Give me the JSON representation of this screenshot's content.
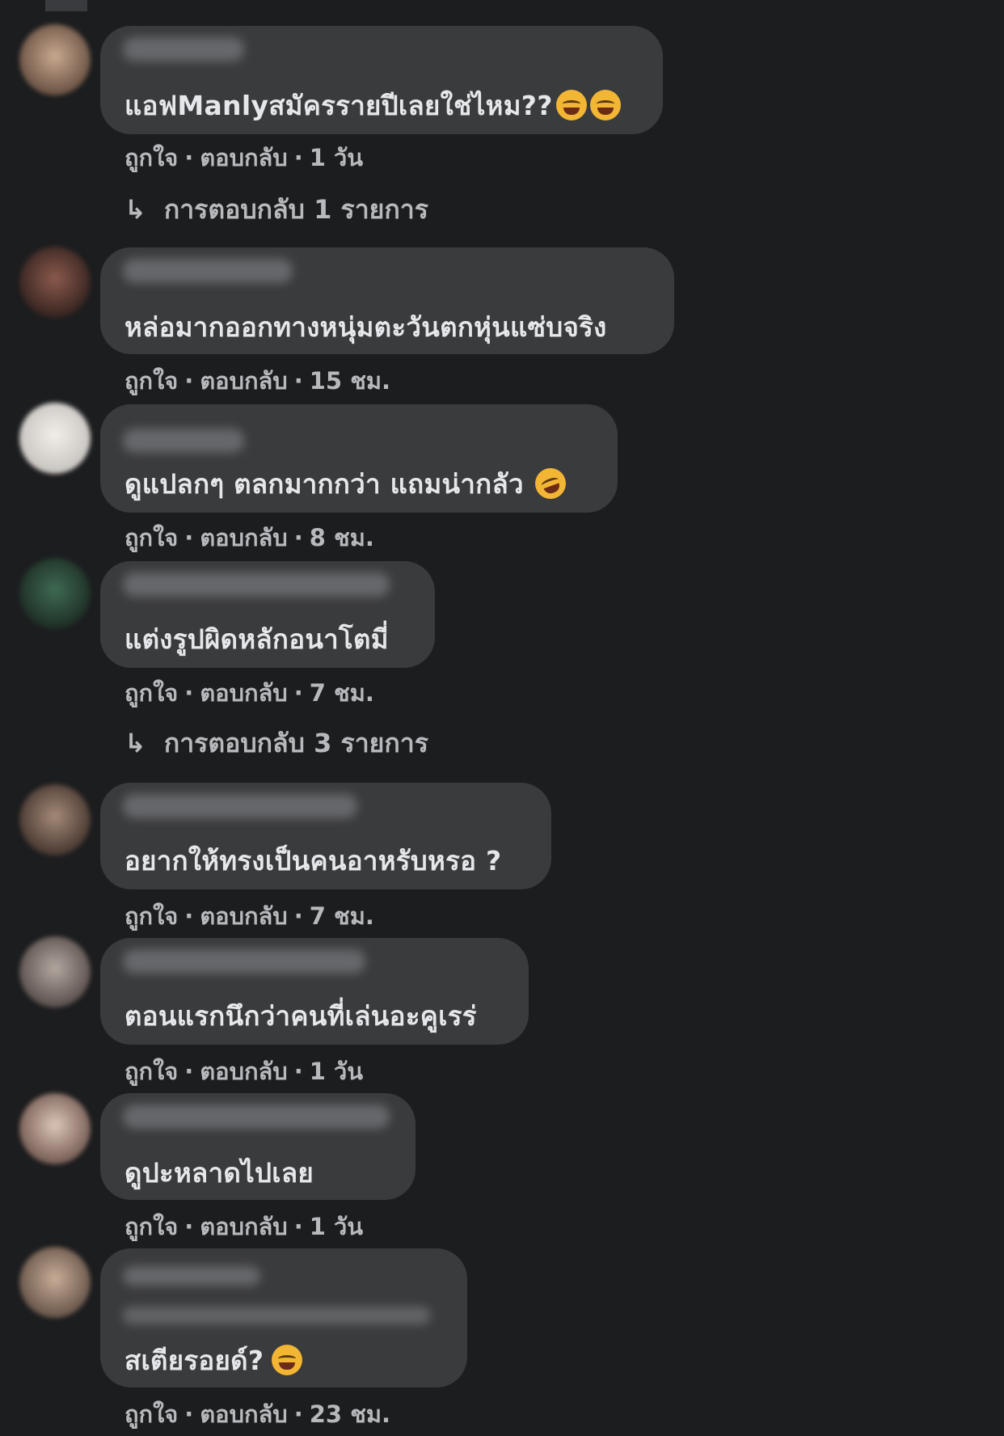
{
  "comments": [
    {
      "text": "แอฟManlyสมัครรายปีเลยใช่ไหม??",
      "emoji_icon": [
        "tears-of-joy-icon",
        "tears-of-joy-icon"
      ],
      "like": "ถูกใจ",
      "reply": "ตอบกลับ",
      "time": "1 วัน",
      "replies_label": "การตอบกลับ 1 รายการ"
    },
    {
      "text": "หล่อมากออกทางหนุ่มตะวันตกหุ่นแซ่บจริง",
      "like": "ถูกใจ",
      "reply": "ตอบกลับ",
      "time": "15 ชม."
    },
    {
      "text": "ดูแปลกๆ ตลกมากกว่า แถมน่ากลัว",
      "emoji_icon": [
        "rolling-laughing-icon"
      ],
      "like": "ถูกใจ",
      "reply": "ตอบกลับ",
      "time": "8 ชม."
    },
    {
      "text": "แต่งรูปผิดหลักอนาโตมี่",
      "like": "ถูกใจ",
      "reply": "ตอบกลับ",
      "time": "7 ชม.",
      "replies_label": "การตอบกลับ 3 รายการ"
    },
    {
      "text": "อยากให้ทรงเป็นคนอาหรับหรอ ?",
      "like": "ถูกใจ",
      "reply": "ตอบกลับ",
      "time": "7 ชม."
    },
    {
      "text": "ตอนแรกนึกว่าคนที่เล่นอะคูเรร่",
      "like": "ถูกใจ",
      "reply": "ตอบกลับ",
      "time": "1 วัน"
    },
    {
      "text": "ดูปะหลาดไปเลย",
      "like": "ถูกใจ",
      "reply": "ตอบกลับ",
      "time": "1 วัน"
    },
    {
      "text": "สเตียรอยด์?",
      "emoji_icon": [
        "grinning-sweat-icon"
      ],
      "like": "ถูกใจ",
      "reply": "ตอบกลับ",
      "time": "23 ชม."
    }
  ],
  "separator": "·",
  "colors": {
    "background": "#1c1d1f",
    "bubble": "#3a3b3d",
    "text": "#e6e7ea",
    "meta": "#b8b9bd"
  }
}
